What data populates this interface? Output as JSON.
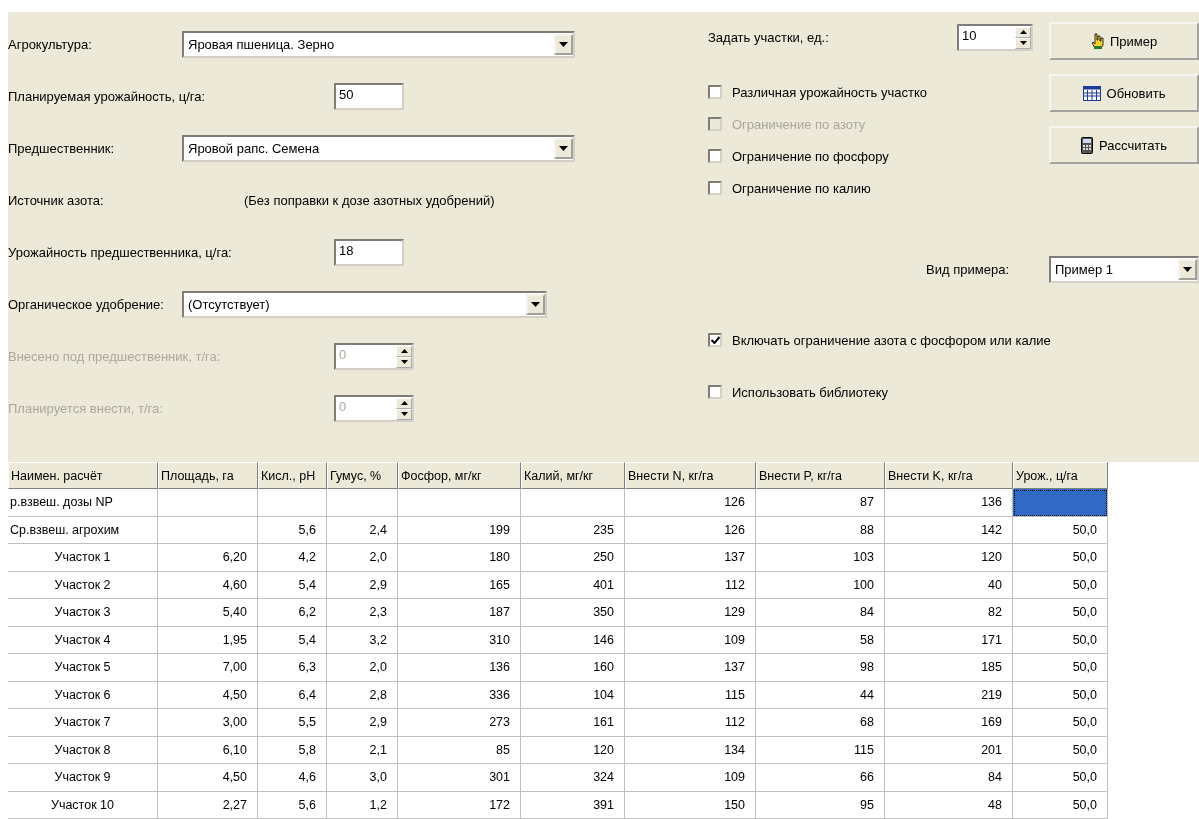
{
  "form": {
    "fields": [
      {
        "kind": "combo",
        "label": "Агрокультура:",
        "value": "Яровая пшеница. Зерно",
        "disabled": false
      },
      {
        "kind": "edit",
        "label": "Планируемая урожайность, ц/га:",
        "value": "50",
        "disabled": false
      },
      {
        "kind": "combo",
        "label": "Предшественник:",
        "value": "Яровой рапс. Семена",
        "disabled": false
      },
      {
        "kind": "text",
        "label": "Источник азота:",
        "value": "(Без поправки к дозе азотных удобрений)",
        "disabled": false
      },
      {
        "kind": "edit",
        "label": "Урожайность предшественника, ц/га:",
        "value": "18",
        "disabled": false
      },
      {
        "kind": "combo",
        "label": "Органическое удобрение:",
        "value": "(Отсутствует)",
        "disabled": false
      },
      {
        "kind": "spin",
        "label": "Внесено под предшественник, т/га:",
        "value": "0",
        "disabled": true
      },
      {
        "kind": "spin",
        "label": "Планируется внести, т/га:",
        "value": "0",
        "disabled": true
      }
    ]
  },
  "plots": {
    "label": "Задать участки, ед.:",
    "value": "10"
  },
  "buttons": [
    "Пример",
    "Обновить",
    "Рассчитать"
  ],
  "limits": [
    {
      "label": "Различная урожайность участко",
      "checked": false,
      "disabled": false
    },
    {
      "label": "Ограничение по азоту",
      "checked": false,
      "disabled": true
    },
    {
      "label": "Ограничение по фосфору",
      "checked": false,
      "disabled": false
    },
    {
      "label": "Ограничение по калию",
      "checked": false,
      "disabled": false
    }
  ],
  "example_type": {
    "label": "Вид примера:",
    "value": "Пример 1"
  },
  "options": [
    {
      "label": "Включать ограничение азота с фосфором или калие",
      "checked": true,
      "disabled": false
    },
    {
      "label": "Использовать библиотеку",
      "checked": false,
      "disabled": false
    }
  ],
  "table": {
    "columns": [
      "Наимен. расчёт",
      "Площадь, га",
      "Кисл., pH",
      "Гумус, %",
      "Фосфор, мг/кг",
      "Калий, мг/кг",
      "Внести N, кг/га",
      "Внести P, кг/га",
      "Внести K, кг/га",
      "Урож., ц/га"
    ],
    "rows": [
      {
        "kind": "total",
        "selected": true,
        "cells": [
          "р.взвеш. дозы NP",
          "",
          "",
          "",
          "",
          "",
          "126",
          "87",
          "136",
          ""
        ]
      },
      {
        "kind": "total",
        "selected": false,
        "cells": [
          "Ср.взвеш. агрохим",
          "",
          "5,6",
          "2,4",
          "199",
          "235",
          "126",
          "88",
          "142",
          "50,0"
        ]
      },
      {
        "kind": "plot",
        "selected": false,
        "cells": [
          "Участок 1",
          "6,20",
          "4,2",
          "2,0",
          "180",
          "250",
          "137",
          "103",
          "120",
          "50,0"
        ]
      },
      {
        "kind": "plot",
        "selected": false,
        "cells": [
          "Участок 2",
          "4,60",
          "5,4",
          "2,9",
          "165",
          "401",
          "112",
          "100",
          "40",
          "50,0"
        ]
      },
      {
        "kind": "plot",
        "selected": false,
        "cells": [
          "Участок 3",
          "5,40",
          "6,2",
          "2,3",
          "187",
          "350",
          "129",
          "84",
          "82",
          "50,0"
        ]
      },
      {
        "kind": "plot",
        "selected": false,
        "cells": [
          "Участок 4",
          "1,95",
          "5,4",
          "3,2",
          "310",
          "146",
          "109",
          "58",
          "171",
          "50,0"
        ]
      },
      {
        "kind": "plot",
        "selected": false,
        "cells": [
          "Участок 5",
          "7,00",
          "6,3",
          "2,0",
          "136",
          "160",
          "137",
          "98",
          "185",
          "50,0"
        ]
      },
      {
        "kind": "plot",
        "selected": false,
        "cells": [
          "Участок 6",
          "4,50",
          "6,4",
          "2,8",
          "336",
          "104",
          "115",
          "44",
          "219",
          "50,0"
        ]
      },
      {
        "kind": "plot",
        "selected": false,
        "cells": [
          "Участок 7",
          "3,00",
          "5,5",
          "2,9",
          "273",
          "161",
          "112",
          "68",
          "169",
          "50,0"
        ]
      },
      {
        "kind": "plot",
        "selected": false,
        "cells": [
          "Участок 8",
          "6,10",
          "5,8",
          "2,1",
          "85",
          "120",
          "134",
          "115",
          "201",
          "50,0"
        ]
      },
      {
        "kind": "plot",
        "selected": false,
        "cells": [
          "Участок 9",
          "4,50",
          "4,6",
          "3,0",
          "301",
          "324",
          "109",
          "66",
          "84",
          "50,0"
        ]
      },
      {
        "kind": "plot",
        "selected": false,
        "cells": [
          "Участок 10",
          "2,27",
          "5,6",
          "1,2",
          "172",
          "391",
          "150",
          "95",
          "48",
          "50,0"
        ]
      }
    ]
  }
}
